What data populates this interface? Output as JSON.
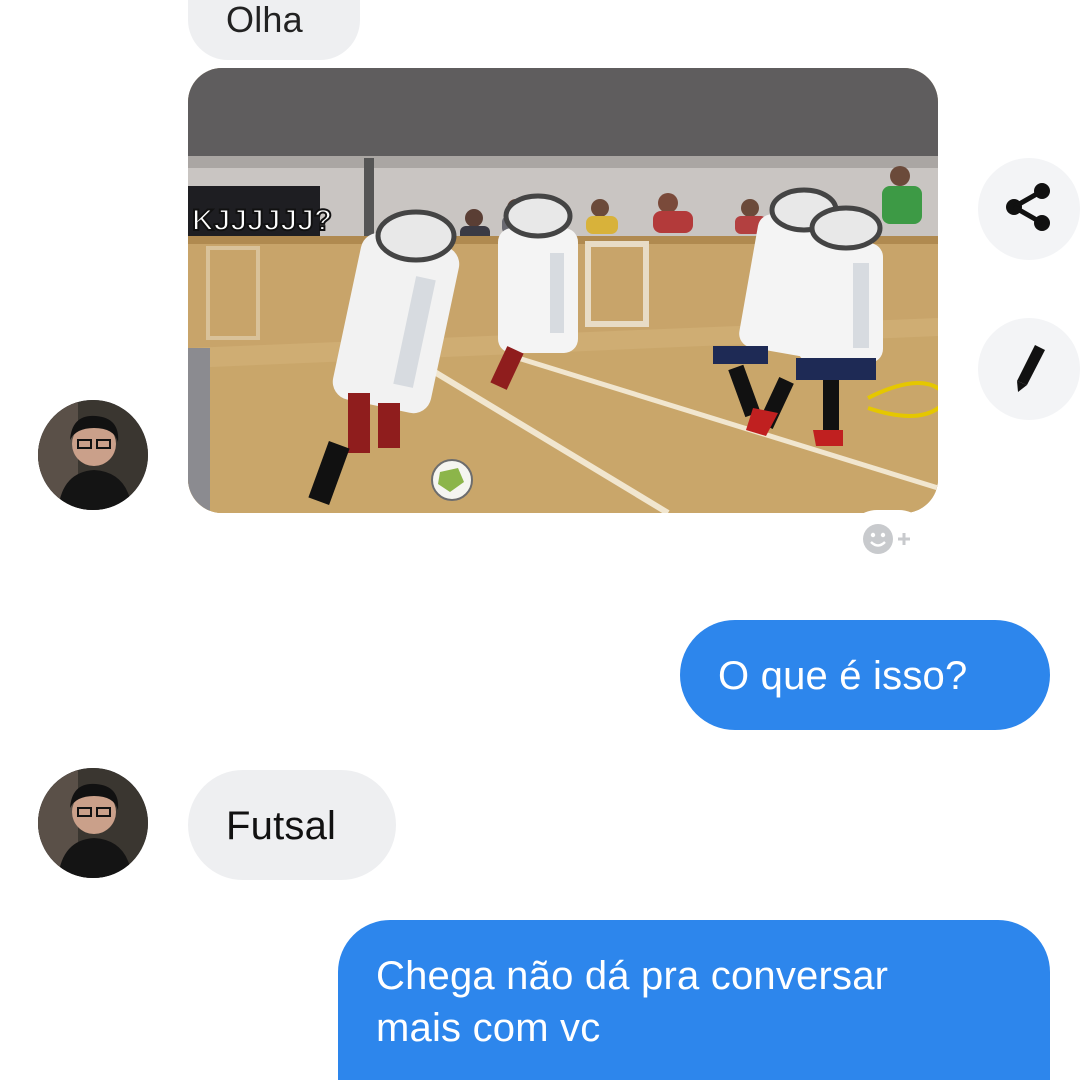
{
  "conversation": {
    "messages": [
      {
        "sender": "contact",
        "type": "text",
        "text": "Olha"
      },
      {
        "sender": "contact",
        "type": "image",
        "image_overlay_text": "KJJJJJJ?"
      },
      {
        "sender": "me",
        "type": "text",
        "text": "O que é isso?"
      },
      {
        "sender": "contact",
        "type": "text",
        "text": "Futsal"
      },
      {
        "sender": "me",
        "type": "text",
        "lines": [
          "Chega não dá pra conversar",
          "mais com vc"
        ]
      }
    ]
  },
  "actions": {
    "share_icon": "share-icon",
    "edit_icon": "pencil-icon",
    "react_icon": "smiley-plus-icon"
  },
  "colors": {
    "outgoing_bubble": "#2d86ec",
    "incoming_bubble": "#eeeff1",
    "background": "#ffffff"
  }
}
